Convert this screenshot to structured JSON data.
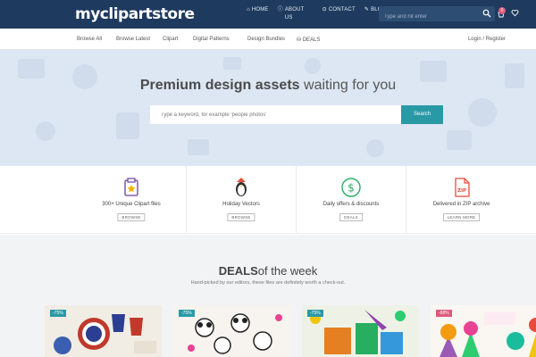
{
  "header": {
    "logo": "myclipartstore",
    "nav": [
      {
        "icon": "home-icon",
        "label": "HOME"
      },
      {
        "icon": "info-icon",
        "label": "ABOUT US"
      },
      {
        "icon": "contact-icon",
        "label": "CONTACT"
      },
      {
        "icon": "pencil-icon",
        "label": "BLOG"
      }
    ],
    "search_placeholder": "Type and hit enter",
    "cart_count": "0"
  },
  "subnav": {
    "links": [
      "Browse All",
      "Browse Latest",
      "Clipart",
      "Digital Patterns",
      "Design Bundles",
      "DEALS"
    ],
    "login": "Login / Register"
  },
  "hero": {
    "title_bold": "Premium design assets",
    "title_rest": " waiting for you",
    "search_placeholder": "Type a keyword, for example 'people photos'",
    "search_button": "Search"
  },
  "features": [
    {
      "title": "300+ Unique Clipart files",
      "button": "BROWSE",
      "icon": "clipart-icon"
    },
    {
      "title": "Holiday Vectors",
      "button": "BROWSE",
      "icon": "penguin-icon"
    },
    {
      "title": "Daily offers & discounts",
      "button": "DEALS",
      "icon": "dollar-icon"
    },
    {
      "title": "Delivered in ZIP archive",
      "button": "LEARN MORE",
      "icon": "zip-file-icon"
    }
  ],
  "deals": {
    "title_bold": "DEALS",
    "title_rest": "of the week",
    "subtitle": "Hand-picked by our editors, these files are definitely worth a check-out.",
    "cards": [
      {
        "discount": "-75%"
      },
      {
        "discount": "-75%"
      },
      {
        "discount": "-75%"
      },
      {
        "discount": "-88%"
      }
    ]
  },
  "colors": {
    "header_bg": "#1e3a5f",
    "accent": "#2a99a6",
    "badge": "#e05a7a",
    "hero_bg": "#dde7f3"
  }
}
